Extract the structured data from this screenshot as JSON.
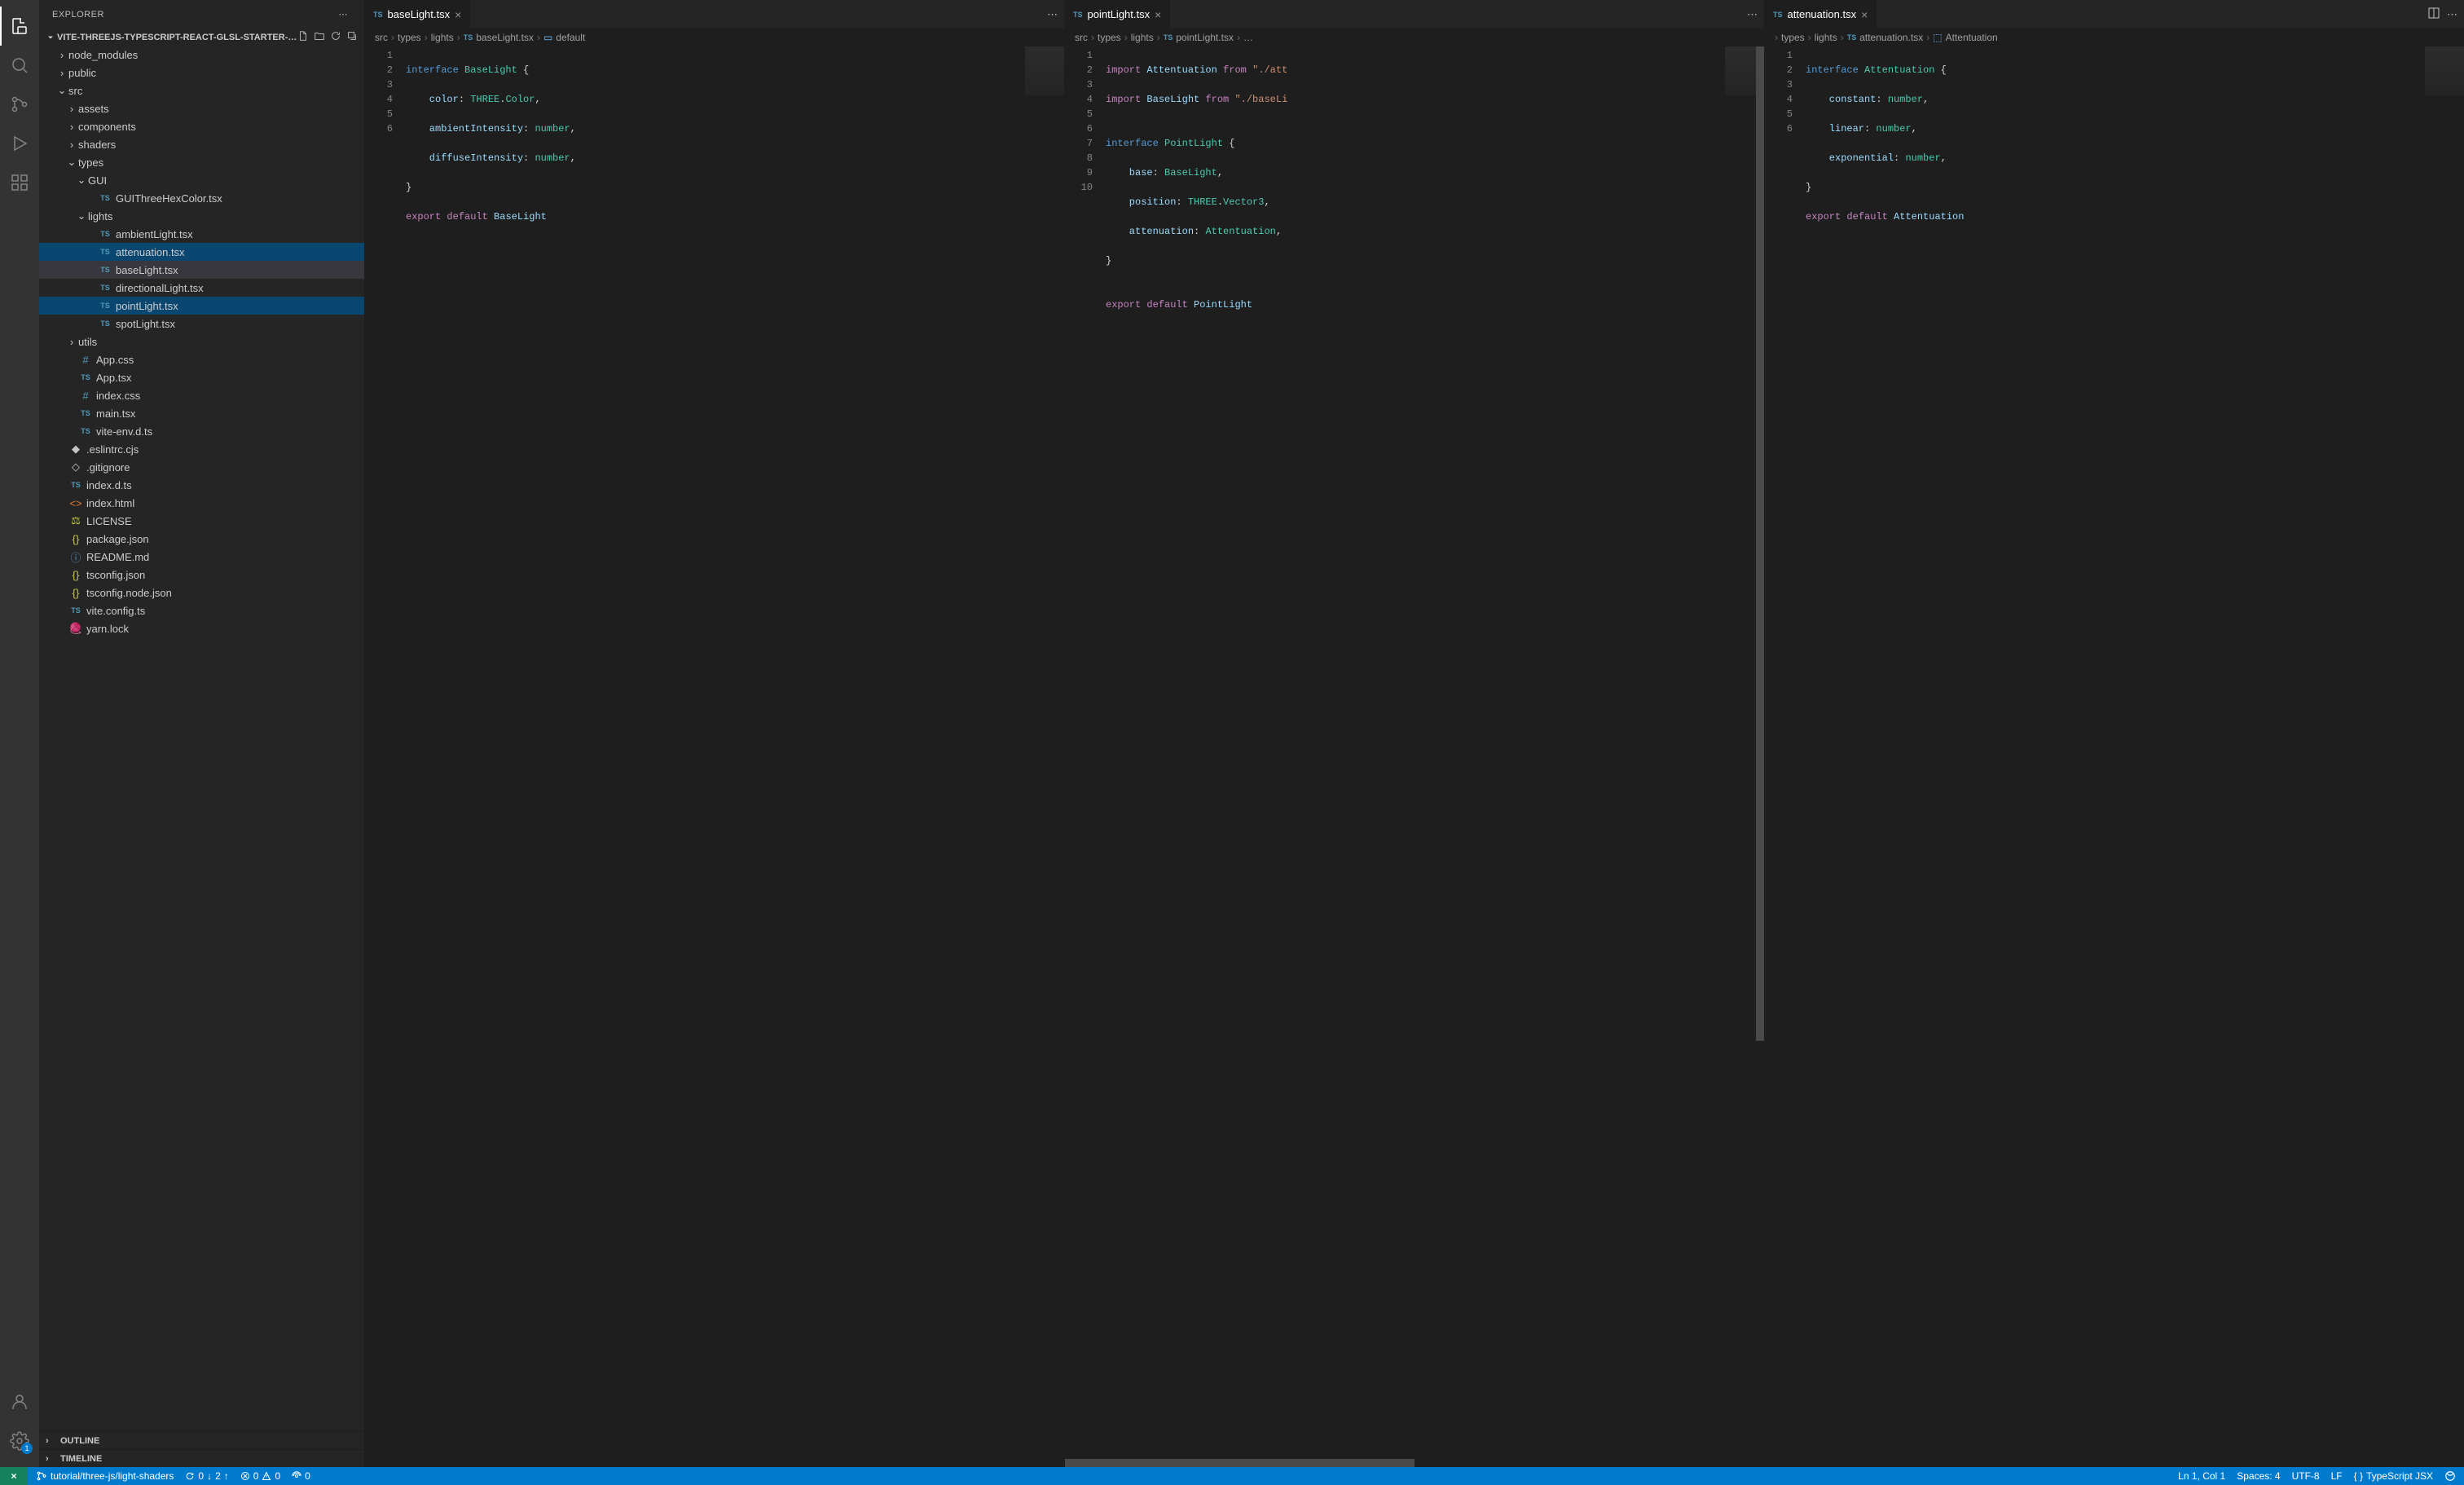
{
  "explorer": {
    "title": "EXPLORER",
    "project": "VITE-THREEJS-TYPESCRIPT-REACT-GLSL-STARTER-…",
    "outline": "OUTLINE",
    "timeline": "TIMELINE"
  },
  "tree": {
    "node_modules": "node_modules",
    "public": "public",
    "src": "src",
    "assets": "assets",
    "components": "components",
    "shaders": "shaders",
    "types": "types",
    "GUI": "GUI",
    "GUIThreeHexColor": "GUIThreeHexColor.tsx",
    "lights": "lights",
    "ambientLight": "ambientLight.tsx",
    "attenuation": "attenuation.tsx",
    "baseLight": "baseLight.tsx",
    "directionalLight": "directionalLight.tsx",
    "pointLight": "pointLight.tsx",
    "spotLight": "spotLight.tsx",
    "utils": "utils",
    "App_css": "App.css",
    "App_tsx": "App.tsx",
    "index_css": "index.css",
    "main_tsx": "main.tsx",
    "vite_env": "vite-env.d.ts",
    "eslintrc": ".eslintrc.cjs",
    "gitignore": ".gitignore",
    "index_d_ts": "index.d.ts",
    "index_html": "index.html",
    "LICENSE": "LICENSE",
    "package_json": "package.json",
    "README": "README.md",
    "tsconfig": "tsconfig.json",
    "tsconfig_node": "tsconfig.node.json",
    "vite_config": "vite.config.ts",
    "yarn_lock": "yarn.lock"
  },
  "tabs": {
    "baseLight": "baseLight.tsx",
    "pointLight": "pointLight.tsx",
    "attenuation": "attenuation.tsx"
  },
  "breadcrumbs": {
    "p1": [
      "src",
      "types",
      "lights",
      "baseLight.tsx",
      "default"
    ],
    "p2": [
      "src",
      "types",
      "lights",
      "pointLight.tsx",
      "…"
    ],
    "p3": [
      "types",
      "lights",
      "attenuation.tsx",
      "Attentuation"
    ]
  },
  "code": {
    "baseLight": {
      "lines": [
        1,
        2,
        3,
        4,
        5,
        6
      ],
      "l1_a": "interface",
      "l1_b": "BaseLight",
      "l1_c": " {",
      "l2_a": "    color",
      "l2_b": ": ",
      "l2_c": "THREE",
      "l2_d": ".",
      "l2_e": "Color",
      "l2_f": ",",
      "l3_a": "    ambientIntensity",
      "l3_b": ": ",
      "l3_c": "number",
      "l3_d": ",",
      "l4_a": "    diffuseIntensity",
      "l4_b": ": ",
      "l4_c": "number",
      "l4_d": ",",
      "l5": "}",
      "l6_a": "export",
      "l6_b": "default",
      "l6_c": "BaseLight"
    },
    "pointLight": {
      "lines": [
        1,
        2,
        3,
        4,
        5,
        6,
        7,
        8,
        9,
        10
      ],
      "l1_a": "import",
      "l1_b": "Attentuation",
      "l1_c": "from",
      "l1_d": "\"./att",
      "l2_a": "import",
      "l2_b": "BaseLight",
      "l2_c": "from",
      "l2_d": "\"./baseLi",
      "l3": "",
      "l4_a": "interface",
      "l4_b": "PointLight",
      "l4_c": " {",
      "l5_a": "    base",
      "l5_b": ": ",
      "l5_c": "BaseLight",
      "l5_d": ",",
      "l6_a": "    position",
      "l6_b": ": ",
      "l6_c": "THREE",
      "l6_d": ".",
      "l6_e": "Vector3",
      "l6_f": ",",
      "l7_a": "    attenuation",
      "l7_b": ": ",
      "l7_c": "Attentuation",
      "l7_d": ",",
      "l8": "}",
      "l9": "",
      "l10_a": "export",
      "l10_b": "default",
      "l10_c": "PointLight"
    },
    "attenuation": {
      "lines": [
        1,
        2,
        3,
        4,
        5,
        6
      ],
      "l1_a": "interface",
      "l1_b": "Attentuation",
      "l1_c": " {",
      "l2_a": "    constant",
      "l2_b": ": ",
      "l2_c": "number",
      "l2_d": ",",
      "l3_a": "    linear",
      "l3_b": ": ",
      "l3_c": "number",
      "l3_d": ",",
      "l4_a": "    exponential",
      "l4_b": ": ",
      "l4_c": "number",
      "l4_d": ",",
      "l5": "}",
      "l6_a": "export",
      "l6_b": "default",
      "l6_c": "Attentuation"
    },
    "ts": "TS"
  },
  "status": {
    "branch": "tutorial/three-js/light-shaders",
    "sync_down": "0",
    "sync_down_arrow": "↓",
    "sync_up": "2",
    "sync_up_arrow": "↑",
    "errors": "0",
    "warnings": "0",
    "radio": "0",
    "cursor": "Ln 1, Col 1",
    "spaces": "Spaces: 4",
    "encoding": "UTF-8",
    "eol": "LF",
    "lang": "TypeScript JSX"
  },
  "activity": {
    "settings_badge": "1"
  }
}
